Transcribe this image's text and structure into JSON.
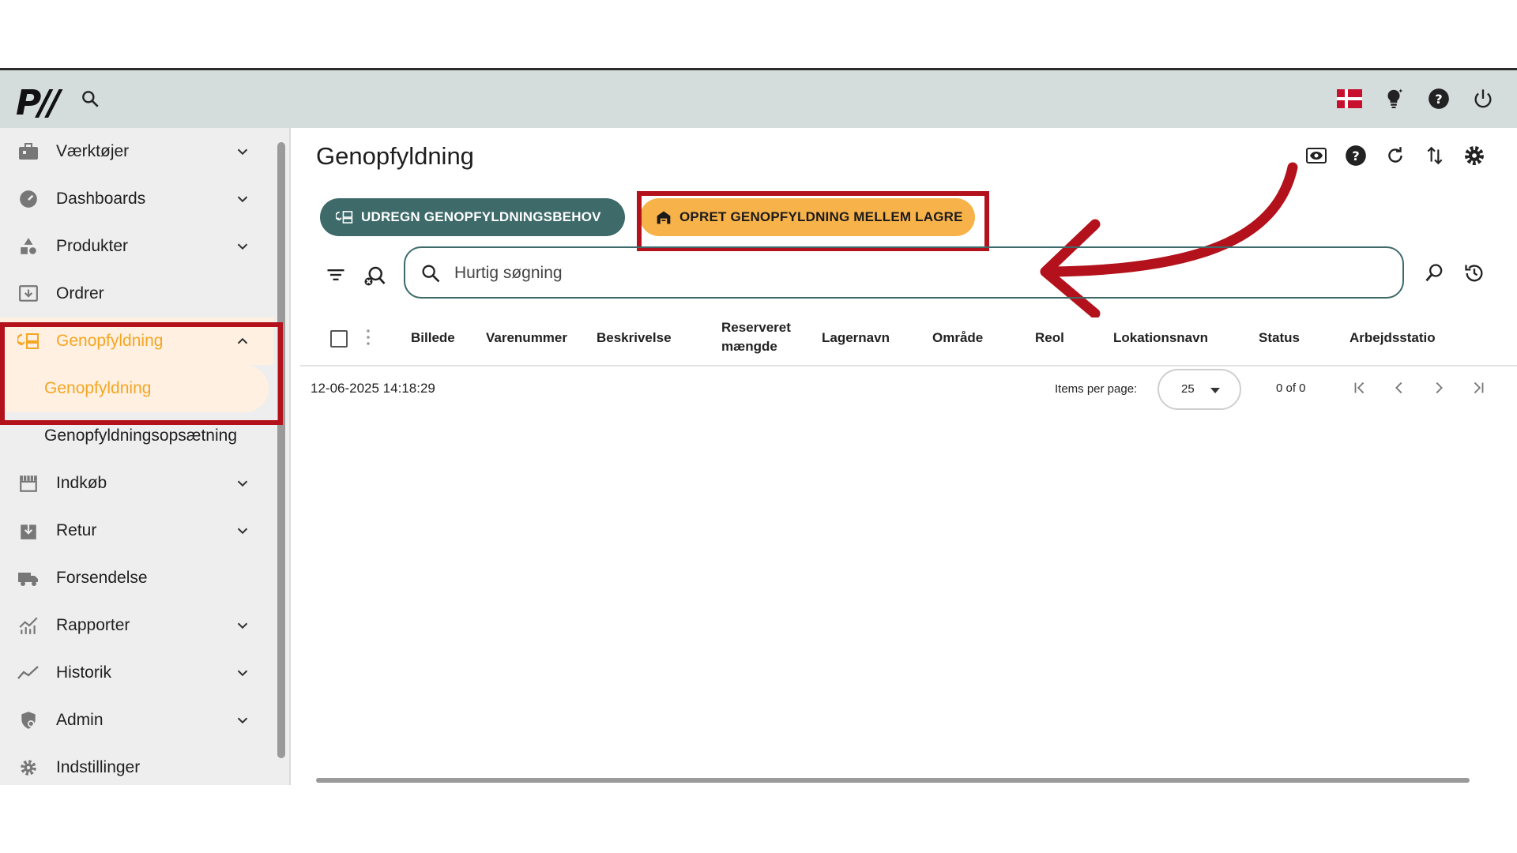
{
  "app": {
    "logo_text": "P//"
  },
  "topbar": {
    "icons": [
      "search-icon",
      "danish-flag-icon",
      "lightbulb-icon",
      "help-icon",
      "power-icon"
    ]
  },
  "sidebar": {
    "items": [
      {
        "label": "Værktøjer",
        "icon": "toolbox-icon",
        "expandable": true
      },
      {
        "label": "Dashboards",
        "icon": "gauge-icon",
        "expandable": true
      },
      {
        "label": "Produkter",
        "icon": "shapes-icon",
        "expandable": true
      },
      {
        "label": "Ordrer",
        "icon": "order-icon",
        "expandable": false
      },
      {
        "label": "Genopfyldning",
        "icon": "replenish-icon",
        "expandable": true,
        "expanded": true,
        "active": true
      },
      {
        "label": "Indkøb",
        "icon": "store-icon",
        "expandable": true
      },
      {
        "label": "Retur",
        "icon": "return-box-icon",
        "expandable": true
      },
      {
        "label": "Forsendelse",
        "icon": "truck-icon",
        "expandable": false
      },
      {
        "label": "Rapporter",
        "icon": "chart-icon",
        "expandable": true
      },
      {
        "label": "Historik",
        "icon": "trend-icon",
        "expandable": true
      },
      {
        "label": "Admin",
        "icon": "shield-icon",
        "expandable": true
      },
      {
        "label": "Indstillinger",
        "icon": "gear-icon",
        "expandable": false
      }
    ],
    "subitems": [
      {
        "label": "Genopfyldning",
        "active": true
      },
      {
        "label": "Genopfyldningsopsætning",
        "active": false
      }
    ]
  },
  "main": {
    "title": "Genopfyldning",
    "header_icons": [
      "eye-icon",
      "help-icon",
      "refresh-icon",
      "sort-icon",
      "settings-icon"
    ],
    "buttons": {
      "calc": "UDREGN GENOPFYLDNINGSBEHOV",
      "create": "OPRET GENOPFYLDNING MELLEM LAGRE"
    },
    "search": {
      "placeholder": "Hurtig søgning"
    },
    "columns": [
      "Billede",
      "Varenummer",
      "Beskrivelse",
      "Reserveret mængde",
      "Lagernavn",
      "Område",
      "Reol",
      "Lokationsnavn",
      "Status",
      "Arbejdsstatio"
    ],
    "timestamp": "12-06-2025 14:18:29",
    "pagination": {
      "items_per_page_label": "Items per page:",
      "items_per_page": "25",
      "range": "0 of 0"
    }
  },
  "colors": {
    "accent": "#f8b24a",
    "primary": "#3e6a6a",
    "annotation": "#b3121c",
    "topbar": "#d5dcdc"
  }
}
